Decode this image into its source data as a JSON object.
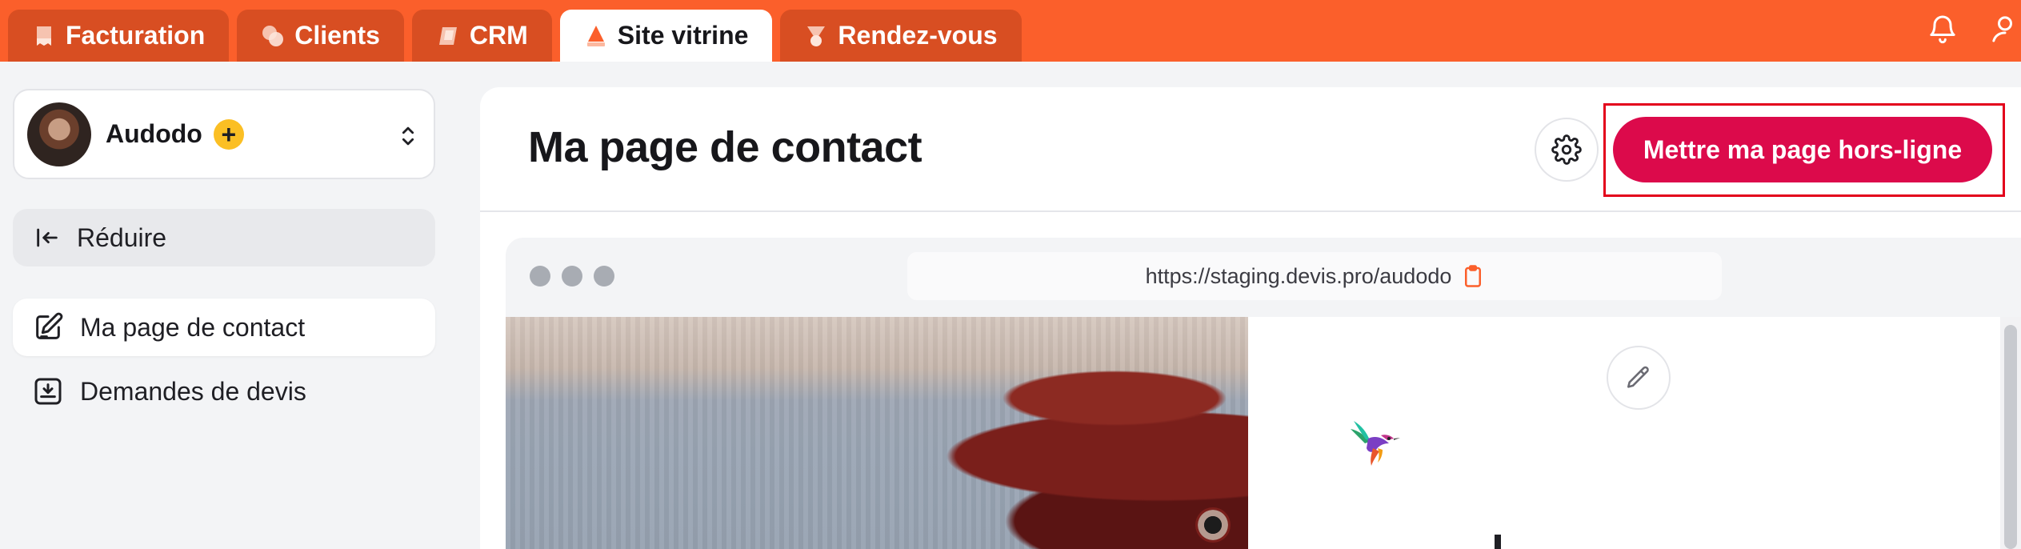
{
  "tabs": [
    {
      "label": "Facturation",
      "icon": "invoice-icon"
    },
    {
      "label": "Clients",
      "icon": "clients-icon"
    },
    {
      "label": "CRM",
      "icon": "crm-icon"
    },
    {
      "label": "Site vitrine",
      "icon": "site-icon",
      "active": true
    },
    {
      "label": "Rendez-vous",
      "icon": "appointment-icon"
    }
  ],
  "topbar": {
    "icons": [
      "bell-icon",
      "user-icon"
    ],
    "color": "#fb5f2b"
  },
  "sidebar": {
    "workspace": {
      "name": "Audodo",
      "badge": "+"
    },
    "collapse_label": "Réduire",
    "items": [
      {
        "label": "Ma page de contact",
        "icon": "edit-page-icon",
        "active": true
      },
      {
        "label": "Demandes de devis",
        "icon": "inbox-download-icon"
      }
    ]
  },
  "main": {
    "title": "Ma page de contact",
    "offline_button": "Mettre ma page hors-ligne",
    "accent": "#dc0a4b",
    "browser": {
      "url": "https://staging.devis.pro/audodo"
    }
  }
}
